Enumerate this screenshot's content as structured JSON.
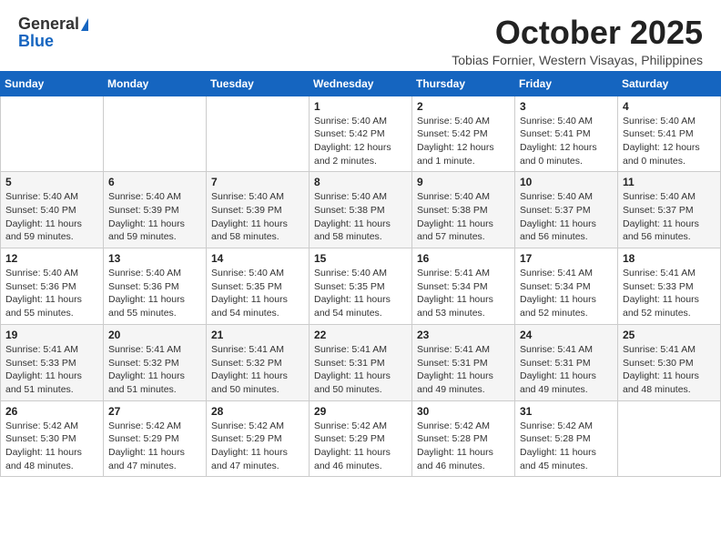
{
  "header": {
    "logo_general": "General",
    "logo_blue": "Blue",
    "month_title": "October 2025",
    "subtitle": "Tobias Fornier, Western Visayas, Philippines"
  },
  "days_of_week": [
    "Sunday",
    "Monday",
    "Tuesday",
    "Wednesday",
    "Thursday",
    "Friday",
    "Saturday"
  ],
  "weeks": [
    [
      {
        "day": "",
        "info": ""
      },
      {
        "day": "",
        "info": ""
      },
      {
        "day": "",
        "info": ""
      },
      {
        "day": "1",
        "info": "Sunrise: 5:40 AM\nSunset: 5:42 PM\nDaylight: 12 hours\nand 2 minutes."
      },
      {
        "day": "2",
        "info": "Sunrise: 5:40 AM\nSunset: 5:42 PM\nDaylight: 12 hours\nand 1 minute."
      },
      {
        "day": "3",
        "info": "Sunrise: 5:40 AM\nSunset: 5:41 PM\nDaylight: 12 hours\nand 0 minutes."
      },
      {
        "day": "4",
        "info": "Sunrise: 5:40 AM\nSunset: 5:41 PM\nDaylight: 12 hours\nand 0 minutes."
      }
    ],
    [
      {
        "day": "5",
        "info": "Sunrise: 5:40 AM\nSunset: 5:40 PM\nDaylight: 11 hours\nand 59 minutes."
      },
      {
        "day": "6",
        "info": "Sunrise: 5:40 AM\nSunset: 5:39 PM\nDaylight: 11 hours\nand 59 minutes."
      },
      {
        "day": "7",
        "info": "Sunrise: 5:40 AM\nSunset: 5:39 PM\nDaylight: 11 hours\nand 58 minutes."
      },
      {
        "day": "8",
        "info": "Sunrise: 5:40 AM\nSunset: 5:38 PM\nDaylight: 11 hours\nand 58 minutes."
      },
      {
        "day": "9",
        "info": "Sunrise: 5:40 AM\nSunset: 5:38 PM\nDaylight: 11 hours\nand 57 minutes."
      },
      {
        "day": "10",
        "info": "Sunrise: 5:40 AM\nSunset: 5:37 PM\nDaylight: 11 hours\nand 56 minutes."
      },
      {
        "day": "11",
        "info": "Sunrise: 5:40 AM\nSunset: 5:37 PM\nDaylight: 11 hours\nand 56 minutes."
      }
    ],
    [
      {
        "day": "12",
        "info": "Sunrise: 5:40 AM\nSunset: 5:36 PM\nDaylight: 11 hours\nand 55 minutes."
      },
      {
        "day": "13",
        "info": "Sunrise: 5:40 AM\nSunset: 5:36 PM\nDaylight: 11 hours\nand 55 minutes."
      },
      {
        "day": "14",
        "info": "Sunrise: 5:40 AM\nSunset: 5:35 PM\nDaylight: 11 hours\nand 54 minutes."
      },
      {
        "day": "15",
        "info": "Sunrise: 5:40 AM\nSunset: 5:35 PM\nDaylight: 11 hours\nand 54 minutes."
      },
      {
        "day": "16",
        "info": "Sunrise: 5:41 AM\nSunset: 5:34 PM\nDaylight: 11 hours\nand 53 minutes."
      },
      {
        "day": "17",
        "info": "Sunrise: 5:41 AM\nSunset: 5:34 PM\nDaylight: 11 hours\nand 52 minutes."
      },
      {
        "day": "18",
        "info": "Sunrise: 5:41 AM\nSunset: 5:33 PM\nDaylight: 11 hours\nand 52 minutes."
      }
    ],
    [
      {
        "day": "19",
        "info": "Sunrise: 5:41 AM\nSunset: 5:33 PM\nDaylight: 11 hours\nand 51 minutes."
      },
      {
        "day": "20",
        "info": "Sunrise: 5:41 AM\nSunset: 5:32 PM\nDaylight: 11 hours\nand 51 minutes."
      },
      {
        "day": "21",
        "info": "Sunrise: 5:41 AM\nSunset: 5:32 PM\nDaylight: 11 hours\nand 50 minutes."
      },
      {
        "day": "22",
        "info": "Sunrise: 5:41 AM\nSunset: 5:31 PM\nDaylight: 11 hours\nand 50 minutes."
      },
      {
        "day": "23",
        "info": "Sunrise: 5:41 AM\nSunset: 5:31 PM\nDaylight: 11 hours\nand 49 minutes."
      },
      {
        "day": "24",
        "info": "Sunrise: 5:41 AM\nSunset: 5:31 PM\nDaylight: 11 hours\nand 49 minutes."
      },
      {
        "day": "25",
        "info": "Sunrise: 5:41 AM\nSunset: 5:30 PM\nDaylight: 11 hours\nand 48 minutes."
      }
    ],
    [
      {
        "day": "26",
        "info": "Sunrise: 5:42 AM\nSunset: 5:30 PM\nDaylight: 11 hours\nand 48 minutes."
      },
      {
        "day": "27",
        "info": "Sunrise: 5:42 AM\nSunset: 5:29 PM\nDaylight: 11 hours\nand 47 minutes."
      },
      {
        "day": "28",
        "info": "Sunrise: 5:42 AM\nSunset: 5:29 PM\nDaylight: 11 hours\nand 47 minutes."
      },
      {
        "day": "29",
        "info": "Sunrise: 5:42 AM\nSunset: 5:29 PM\nDaylight: 11 hours\nand 46 minutes."
      },
      {
        "day": "30",
        "info": "Sunrise: 5:42 AM\nSunset: 5:28 PM\nDaylight: 11 hours\nand 46 minutes."
      },
      {
        "day": "31",
        "info": "Sunrise: 5:42 AM\nSunset: 5:28 PM\nDaylight: 11 hours\nand 45 minutes."
      },
      {
        "day": "",
        "info": ""
      }
    ]
  ]
}
